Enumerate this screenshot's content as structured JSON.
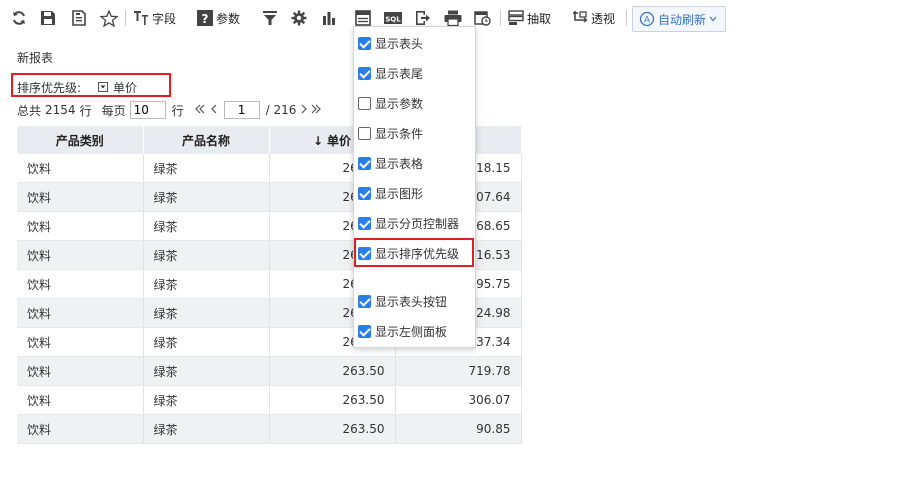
{
  "toolbar": {
    "fields_label": "字段",
    "params_label": "参数",
    "extract_label": "抽取",
    "pivot_label": "透视",
    "auto_refresh_label": "自动刷新",
    "sql_icon_text": "SQL",
    "icons": [
      "refresh-icon",
      "save-icon",
      "save-as-icon",
      "favorite-icon",
      "fields-icon",
      "params-icon",
      "filter-icon",
      "settings-icon",
      "chart-icon",
      "display-options-icon",
      "sql-icon",
      "export-icon",
      "print-icon",
      "schedule-icon",
      "extract-icon",
      "pivot-icon",
      "auto-refresh-icon"
    ]
  },
  "report": {
    "title": "新报表",
    "sort_priority_label": "排序优先级:",
    "sort_field": "单价"
  },
  "pager": {
    "total_prefix": "总共",
    "total_rows": "2154",
    "rows_unit": "行",
    "per_page_label": "每页",
    "per_page_value": "10",
    "per_page_unit": "行",
    "current_page": "1",
    "total_pages": "/ 216"
  },
  "table": {
    "headers": [
      "产品类别",
      "产品名称",
      "单价",
      ""
    ],
    "sorted_column": "单价",
    "sort_direction": "descending",
    "rows": [
      [
        "饮料",
        "绿茶",
        "263.50",
        "218.15"
      ],
      [
        "饮料",
        "绿茶",
        "263.50",
        "007.64"
      ],
      [
        "饮料",
        "绿茶",
        "263.50",
        "68.65"
      ],
      [
        "饮料",
        "绿茶",
        "263.50",
        "116.53"
      ],
      [
        "饮料",
        "绿茶",
        "263.50",
        "95.75"
      ],
      [
        "饮料",
        "绿茶",
        "263.50",
        "124.98"
      ],
      [
        "饮料",
        "绿茶",
        "263.50",
        "237.34"
      ],
      [
        "饮料",
        "绿茶",
        "263.50",
        "719.78"
      ],
      [
        "饮料",
        "绿茶",
        "263.50",
        "306.07"
      ],
      [
        "饮料",
        "绿茶",
        "263.50",
        "90.85"
      ]
    ]
  },
  "display_menu": {
    "items": [
      {
        "label": "显示表头",
        "checked": true
      },
      {
        "label": "显示表尾",
        "checked": true
      },
      {
        "label": "显示参数",
        "checked": false
      },
      {
        "label": "显示条件",
        "checked": false
      },
      {
        "label": "显示表格",
        "checked": true
      },
      {
        "label": "显示图形",
        "checked": true
      },
      {
        "label": "显示分页控制器",
        "checked": true
      },
      {
        "label": "显示排序优先级",
        "checked": true
      },
      {
        "label": "显示表头按钮",
        "checked": true
      },
      {
        "label": "显示左侧面板",
        "checked": true
      }
    ]
  },
  "colors": {
    "accent": "#2b7de9",
    "highlight_border": "#e02020",
    "header_bg": "#e8ebf0",
    "stripe_bg": "#f0f1f3"
  }
}
